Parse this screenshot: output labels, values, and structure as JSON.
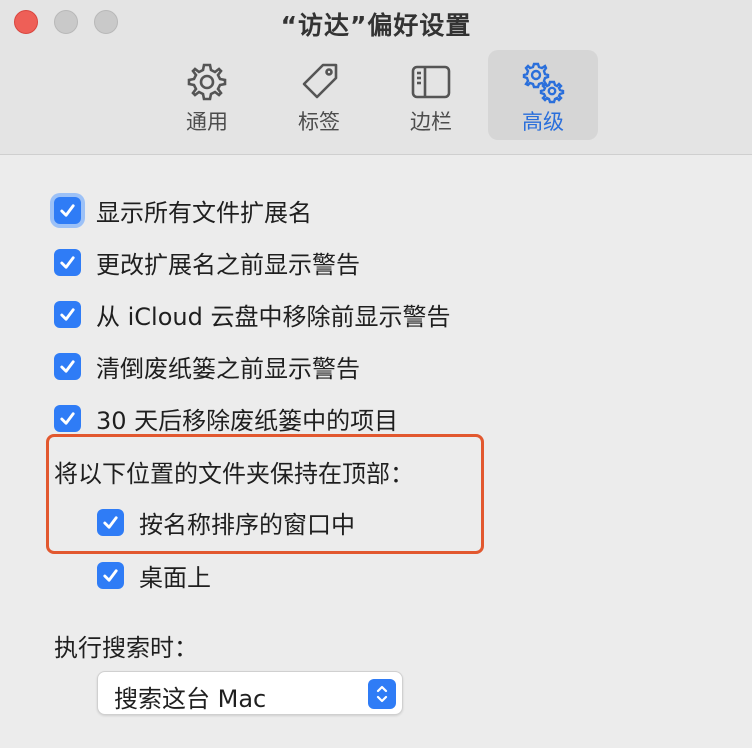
{
  "window": {
    "title": "“访达”偏好设置"
  },
  "tabs": [
    {
      "label": "通用",
      "icon": "gear-icon",
      "active": false
    },
    {
      "label": "标签",
      "icon": "tag-icon",
      "active": false
    },
    {
      "label": "边栏",
      "icon": "sidebar-icon",
      "active": false
    },
    {
      "label": "高级",
      "icon": "gears-icon",
      "active": true
    }
  ],
  "options": [
    {
      "label": "显示所有文件扩展名",
      "checked": true
    },
    {
      "label": "更改扩展名之前显示警告",
      "checked": true
    },
    {
      "label": "从 iCloud 云盘中移除前显示警告",
      "checked": true
    },
    {
      "label": "清倒废纸篓之前显示警告",
      "checked": true
    },
    {
      "label": "30 天后移除废纸篓中的项目",
      "checked": true
    }
  ],
  "folders_on_top": {
    "label": "将以下位置的文件夹保持在顶部：",
    "options": [
      {
        "label": "按名称排序的窗口中",
        "checked": true
      },
      {
        "label": "桌面上",
        "checked": true
      }
    ]
  },
  "search": {
    "label": "执行搜索时：",
    "selected": "搜索这台 Mac"
  },
  "colors": {
    "accent": "#2f7cf6",
    "highlight": "#e2582f"
  }
}
